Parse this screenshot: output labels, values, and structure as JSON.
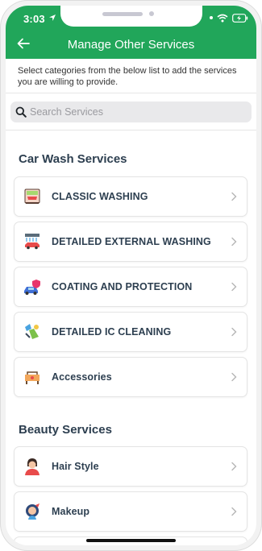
{
  "status_bar": {
    "time": "3:03"
  },
  "header": {
    "title": "Manage Other Services"
  },
  "intro": {
    "text": "Select categories from the below list to add the services you are willing to provide."
  },
  "search": {
    "placeholder": "Search Services",
    "value": ""
  },
  "sections": [
    {
      "title": "Car Wash Services",
      "items": [
        {
          "label": "CLASSIC WASHING",
          "icon": "classic-washing-icon"
        },
        {
          "label": "DETAILED EXTERNAL WASHING",
          "icon": "external-washing-icon"
        },
        {
          "label": "COATING AND PROTECTION",
          "icon": "coating-protection-icon"
        },
        {
          "label": "DETAILED IC CLEANING",
          "icon": "ic-cleaning-icon"
        },
        {
          "label": "Accessories",
          "icon": "accessories-icon"
        }
      ]
    },
    {
      "title": "Beauty Services",
      "items": [
        {
          "label": "Hair Style",
          "icon": "hair-style-icon"
        },
        {
          "label": "Makeup",
          "icon": "makeup-icon"
        }
      ]
    }
  ],
  "colors": {
    "header_green": "#21a65a",
    "text_dark": "#2d3f50",
    "chevron": "#b5b5b5"
  }
}
